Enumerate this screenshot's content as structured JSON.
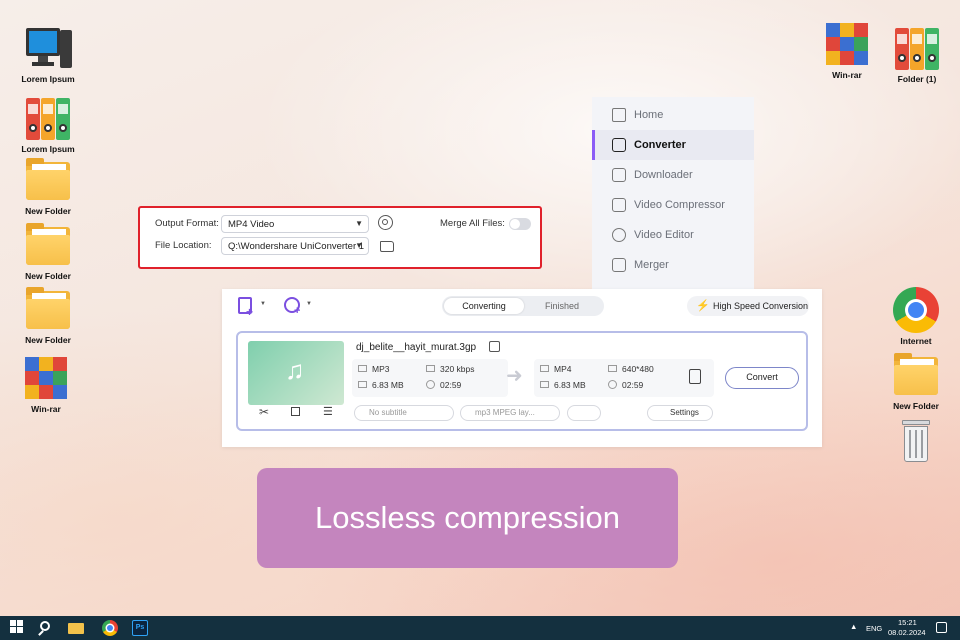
{
  "desktop": {
    "icons_left": [
      {
        "label": "Lorem Ipsum",
        "icon": "computer-icon"
      },
      {
        "label": "Lorem Ipsum",
        "icon": "binders-icon"
      },
      {
        "label": "New Folder",
        "icon": "folder-icon"
      },
      {
        "label": "New Folder",
        "icon": "folder-icon"
      },
      {
        "label": "New Folder",
        "icon": "folder-icon"
      },
      {
        "label": "Win-rar",
        "icon": "winrar-icon"
      }
    ],
    "icons_top_right": [
      {
        "label": "Win-rar",
        "icon": "winrar-icon"
      },
      {
        "label": "Folder (1)",
        "icon": "binders-icon"
      }
    ],
    "icons_right": [
      {
        "label": "Internet",
        "icon": "chrome-icon"
      },
      {
        "label": "New Folder",
        "icon": "folder-icon"
      },
      {
        "label": "",
        "icon": "recycle-bin-icon"
      }
    ]
  },
  "sidebar": {
    "items": [
      {
        "label": "Home",
        "icon": "home-icon",
        "active": false
      },
      {
        "label": "Converter",
        "icon": "converter-icon",
        "active": true
      },
      {
        "label": "Downloader",
        "icon": "download-icon",
        "active": false
      },
      {
        "label": "Video Compressor",
        "icon": "compress-icon",
        "active": false
      },
      {
        "label": "Video Editor",
        "icon": "scissors-icon",
        "active": false
      },
      {
        "label": "Merger",
        "icon": "merge-icon",
        "active": false
      }
    ]
  },
  "settings_panel": {
    "output_format_label": "Output Format:",
    "output_format_value": "MP4 Video",
    "file_location_label": "File Location:",
    "file_location_value": "Q:\\Wondershare UniConverter 1",
    "merge_label": "Merge All Files:",
    "merge_enabled": false
  },
  "converter": {
    "tabs": [
      {
        "label": "Converting",
        "active": true
      },
      {
        "label": "Finished",
        "active": false
      }
    ],
    "high_speed_label": "High Speed Conversion",
    "file": {
      "name": "dj_belite__hayit_murat.3gp",
      "source": {
        "format": "MP3",
        "bitrate": "320 kbps",
        "size": "6.83 MB",
        "duration": "02:59"
      },
      "target": {
        "format": "MP4",
        "resolution": "640*480",
        "size": "6.83 MB",
        "duration": "02:59"
      },
      "subtitle_placeholder": "No subtitle",
      "audio_track": "mp3 MPEG lay...",
      "settings_label": "Settings",
      "convert_label": "Convert"
    }
  },
  "banner": {
    "text": "Lossless compression"
  },
  "taskbar": {
    "language": "ENG",
    "time": "15:21",
    "date": "08.02.2024"
  },
  "colors": {
    "accent_purple": "#8b5cf6",
    "highlight_red": "#e0212b",
    "banner": "#c485be",
    "taskbar": "#14303f"
  }
}
